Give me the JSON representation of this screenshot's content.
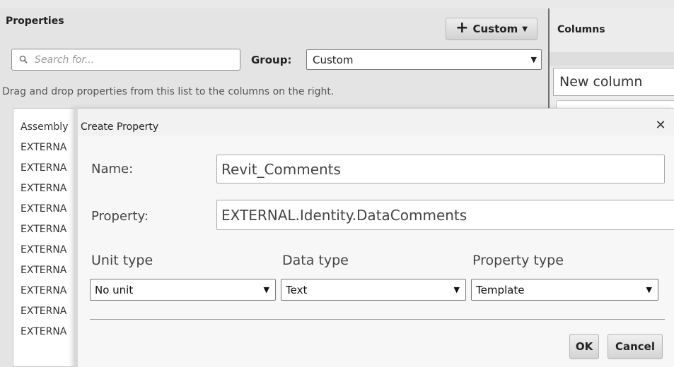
{
  "properties": {
    "title": "Properties",
    "custom_button": {
      "icon": "plus-icon",
      "label": "Custom"
    },
    "search": {
      "placeholder": "Search for..."
    },
    "group_label": "Group:",
    "group_value": "Custom",
    "hint": "Drag and drop properties from this list to the columns on the right.",
    "list_items": [
      "Assembly",
      "EXTERNA",
      "EXTERNA",
      "EXTERNA",
      "EXTERNA",
      "EXTERNA",
      "EXTERNA",
      "EXTERNA",
      "EXTERNA",
      "EXTERNA",
      "EXTERNA"
    ]
  },
  "columns": {
    "title": "Columns",
    "new_column": "New column"
  },
  "dialog": {
    "title": "Create Property",
    "close_glyph": "✕",
    "name_label": "Name:",
    "name_value": "Revit_Comments",
    "property_label": "Property:",
    "property_value": "EXTERNAL.Identity.DataComments",
    "unit_type_label": "Unit type",
    "data_type_label": "Data type",
    "property_type_label": "Property type",
    "unit_type_value": "No unit",
    "data_type_value": "Text",
    "property_type_value": "Template",
    "ok_label": "OK",
    "cancel_label": "Cancel"
  }
}
